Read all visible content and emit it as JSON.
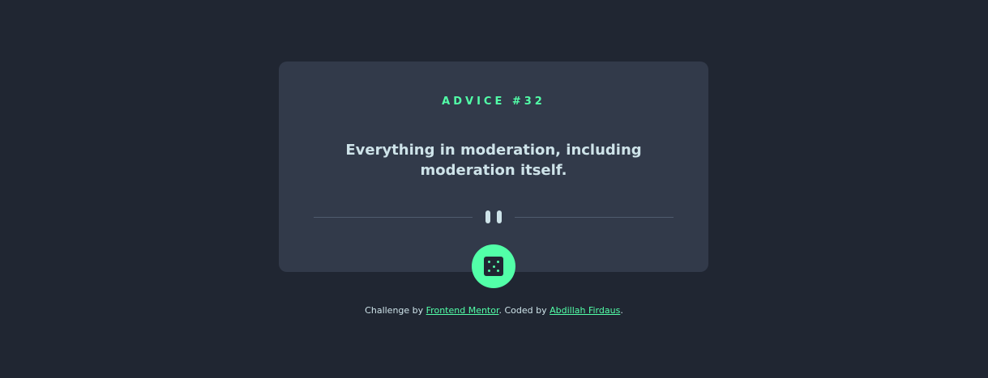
{
  "advice": {
    "label": "ADVICE #32",
    "text": "Everything in moderation, including moderation itself."
  },
  "divider": {
    "icon": "pause-icon"
  },
  "dice_button": {
    "icon": "dice-icon"
  },
  "footer": {
    "prefix": "Challenge by ",
    "link1": "Frontend Mentor",
    "middle": ". Coded by ",
    "link2": "Abdillah Firdaus",
    "suffix": "."
  },
  "colors": {
    "background": "#202632",
    "card": "#323a4a",
    "accent": "#52ffa8",
    "text": "#cee3e9",
    "divider": "#4f5b6e"
  }
}
